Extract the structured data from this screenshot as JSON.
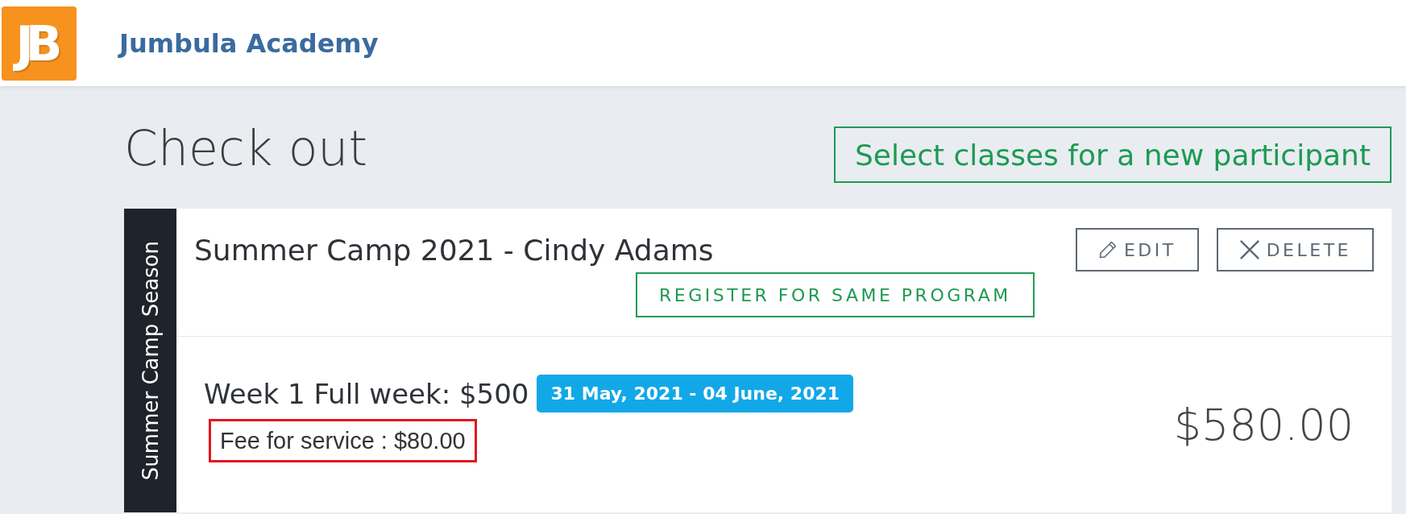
{
  "header": {
    "logo_text": "JB",
    "title": "Jumbula Academy"
  },
  "page": {
    "title": "Check out",
    "new_participant_button": "Select classes for a new participant"
  },
  "cart_items": [
    {
      "season": "Summer Camp Season",
      "title": "Summer Camp 2021 - Cindy Adams",
      "actions": [
        {
          "kind": "edit",
          "label": "EDIT"
        },
        {
          "kind": "delete",
          "label": "DELETE"
        }
      ],
      "register_button": "REGISTER FOR SAME PROGRAM",
      "lines": [
        {
          "name": "Week 1 Full week: $500",
          "dates": "31 May, 2021 - 04 June, 2021",
          "fee": {
            "text": "Fee for service : $80.00",
            "highlighted": true
          }
        }
      ],
      "total": "$580.00"
    }
  ]
}
